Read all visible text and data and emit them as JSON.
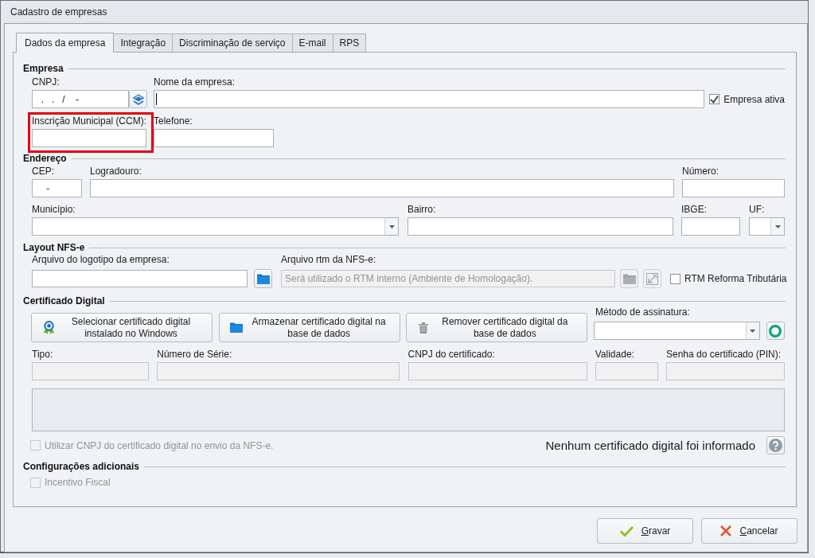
{
  "window": {
    "title": "Cadastro de empresas"
  },
  "tabs": [
    {
      "label": "Dados da empresa",
      "selected": true
    },
    {
      "label": "Integração",
      "selected": false
    },
    {
      "label": "Discriminação de serviço",
      "selected": false
    },
    {
      "label": "E-mail",
      "selected": false
    },
    {
      "label": "RPS",
      "selected": false
    }
  ],
  "empresa": {
    "title": "Empresa",
    "cnpj": {
      "label": "CNPJ:",
      "value": "  .   .   /    -"
    },
    "nome_da_empresa": {
      "label": "Nome da empresa:",
      "focused": true
    },
    "empresa_ativa": {
      "label": "Empresa ativa",
      "checked": true,
      "disabled": false
    },
    "inscricao_municipal": {
      "label": "Inscrição Municipal (CCM):",
      "highlighted": true
    },
    "telefone": {
      "label": "Telefone:"
    }
  },
  "endereco": {
    "title": "Endereço",
    "cep": {
      "label": "CEP:",
      "value": "    -"
    },
    "logradouro": {
      "label": "Logradouro:"
    },
    "numero": {
      "label": "Número:"
    },
    "municipio": {
      "label": "Município:"
    },
    "bairro": {
      "label": "Bairro:"
    },
    "ibge": {
      "label": "IBGE:"
    },
    "uf": {
      "label": "UF:"
    }
  },
  "layout_nfse": {
    "title": "Layout NFS-e",
    "arquivo_logotipo": {
      "label": "Arquivo do logotipo da empresa:",
      "disabled": false
    },
    "arquivo_rtm": {
      "label": "Arquivo rtm da NFS-e:",
      "placeholder": "Será utilizado o RTM interno (Ambiente de Homologação).",
      "disabled": true
    },
    "rtm_reforma_tributaria": {
      "label": "RTM Reforma Tributária",
      "checked": false,
      "disabled": false
    }
  },
  "certificado_digital": {
    "title": "Certificado Digital",
    "actions": [
      {
        "kind": "install",
        "label": "Selecionar certificado digital instalado no Windows"
      },
      {
        "kind": "store",
        "label": "Armazenar certificado digital na base de dados"
      },
      {
        "kind": "remove",
        "label": "Remover certificado digital da base de dados"
      }
    ],
    "metodo_de_assinatura": {
      "label": "Método de assinatura:"
    },
    "fields": [
      {
        "label": "Tipo:",
        "disabled": true
      },
      {
        "label": "Número de Série:",
        "disabled": true
      },
      {
        "label": "CNPJ do certificado:",
        "disabled": true
      },
      {
        "label": "Validade:",
        "disabled": true
      },
      {
        "label": "Senha do certificado (PIN):",
        "disabled": true
      }
    ],
    "utilizar_cnpj": {
      "label": "Utilizar CNPJ do certificado digital no envio da NFS-e.",
      "checked": false,
      "disabled": true
    },
    "status": "Nenhum certificado digital foi informado"
  },
  "configuracoes_adicionais": {
    "title": "Configurações adicionais",
    "incentivo_fiscal": {
      "label": "Incentivo Fiscal",
      "checked": false,
      "disabled": true
    }
  },
  "buttons": [
    {
      "kind": "save",
      "label": "Gravar"
    },
    {
      "kind": "cancel",
      "label": "Cancelar"
    }
  ]
}
